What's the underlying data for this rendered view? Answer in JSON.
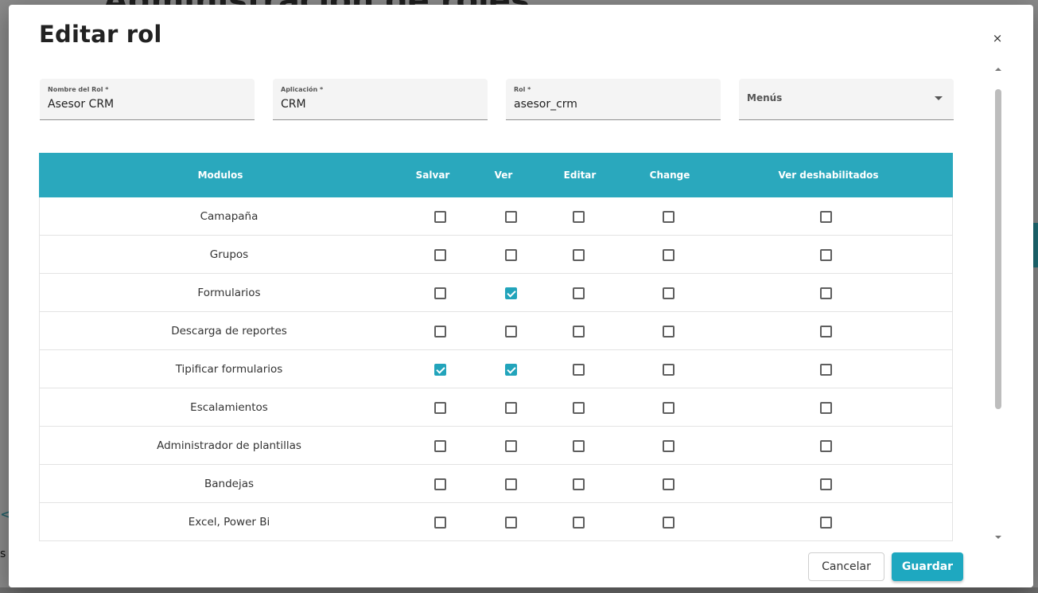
{
  "background": {
    "title": "Administración de roles",
    "left_glyph": "<",
    "left_text": "s"
  },
  "modal": {
    "title": "Editar rol",
    "close_symbol": "×"
  },
  "fields": {
    "nombre": {
      "label": "Nombre del Rol *",
      "value": "Asesor CRM"
    },
    "aplicacion": {
      "label": "Aplicación *",
      "value": "CRM"
    },
    "rol": {
      "label": "Rol *",
      "value": "asesor_crm"
    },
    "menus": {
      "label": "Menús"
    }
  },
  "table": {
    "headers": [
      "Modulos",
      "Salvar",
      "Ver",
      "Editar",
      "Change",
      "Ver deshabilitados"
    ],
    "rows": [
      {
        "name": "Camapaña",
        "checks": [
          false,
          false,
          false,
          false,
          false
        ]
      },
      {
        "name": "Grupos",
        "checks": [
          false,
          false,
          false,
          false,
          false
        ]
      },
      {
        "name": "Formularios",
        "checks": [
          false,
          true,
          false,
          false,
          false
        ]
      },
      {
        "name": "Descarga de reportes",
        "checks": [
          false,
          false,
          false,
          false,
          false
        ]
      },
      {
        "name": "Tipificar formularios",
        "checks": [
          true,
          true,
          false,
          false,
          false
        ]
      },
      {
        "name": "Escalamientos",
        "checks": [
          false,
          false,
          false,
          false,
          false
        ]
      },
      {
        "name": "Administrador de plantillas",
        "checks": [
          false,
          false,
          false,
          false,
          false
        ]
      },
      {
        "name": "Bandejas",
        "checks": [
          false,
          false,
          false,
          false,
          false
        ]
      },
      {
        "name": "Excel, Power Bi",
        "checks": [
          false,
          false,
          false,
          false,
          false
        ]
      }
    ]
  },
  "footer": {
    "cancel_label": "Cancelar",
    "save_label": "Guardar"
  },
  "colors": {
    "accent": "#2aa8bd",
    "checkbox_checked": "#22a4bb",
    "save_button": "#1ea8c0"
  }
}
